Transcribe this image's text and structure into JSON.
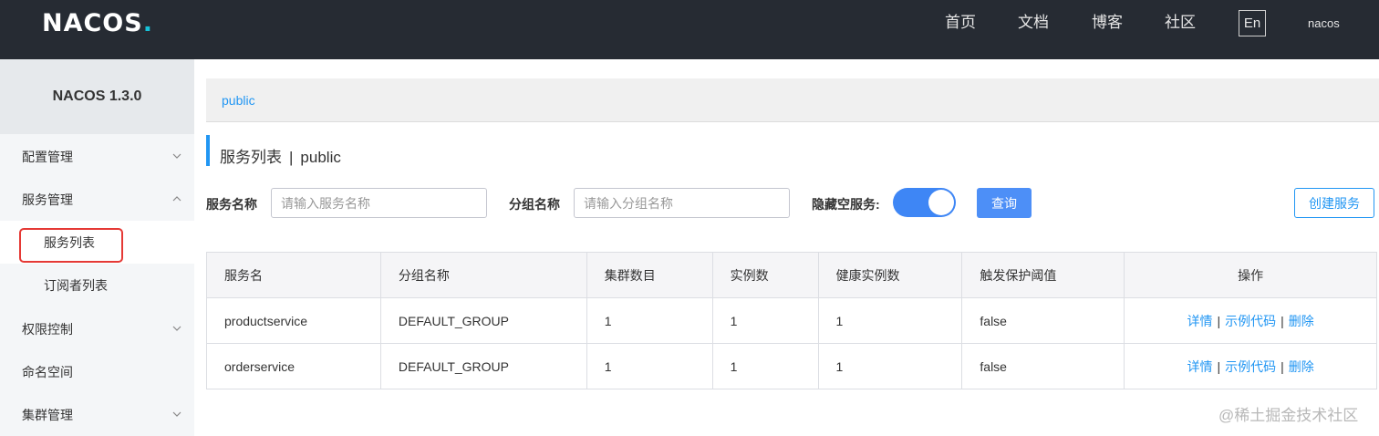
{
  "topbar": {
    "logo_text": "NACOS",
    "logo_dot": ".",
    "nav": [
      "首页",
      "文档",
      "博客",
      "社区"
    ],
    "lang": "En",
    "user": "nacos"
  },
  "sidebar": {
    "title": "NACOS 1.3.0",
    "items": [
      {
        "label": "配置管理",
        "chevron": "chevron-down"
      },
      {
        "label": "服务管理",
        "chevron": "chevron-up"
      },
      {
        "label": "服务列表"
      },
      {
        "label": "订阅者列表"
      },
      {
        "label": "权限控制",
        "chevron": "chevron-down"
      },
      {
        "label": "命名空间"
      },
      {
        "label": "集群管理",
        "chevron": "chevron-down"
      }
    ]
  },
  "main": {
    "namespace": "public",
    "title": "服务列表",
    "title_sep": "|",
    "title_ns": "public",
    "filters": {
      "service_label": "服务名称",
      "service_placeholder": "请输入服务名称",
      "group_label": "分组名称",
      "group_placeholder": "请输入分组名称",
      "hide_empty_label": "隐藏空服务:",
      "hide_empty_on": true
    },
    "query_button": "查询",
    "create_button": "创建服务",
    "table": {
      "headers": [
        "服务名",
        "分组名称",
        "集群数目",
        "实例数",
        "健康实例数",
        "触发保护阈值",
        "操作"
      ],
      "rows": [
        [
          "productservice",
          "DEFAULT_GROUP",
          "1",
          "1",
          "1",
          "false"
        ],
        [
          "orderservice",
          "DEFAULT_GROUP",
          "1",
          "1",
          "1",
          "false"
        ]
      ],
      "actions": [
        "详情",
        "示例代码",
        "删除"
      ],
      "action_sep": "|"
    }
  },
  "watermark": "@稀土掘金技术社区",
  "colors": {
    "topbar": "#262b33",
    "accent": "#2196f3",
    "toggle": "#3e86f5",
    "highlight": "#e53935"
  }
}
